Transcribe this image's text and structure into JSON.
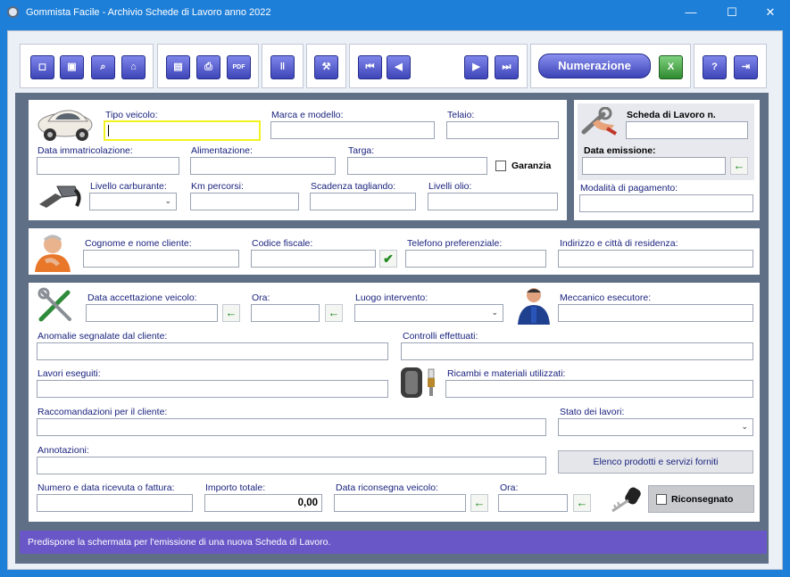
{
  "window": {
    "title": "Gommista Facile - Archivio Schede di Lavoro anno 2022",
    "minimize": "—",
    "maximize": "☐",
    "close": "✕"
  },
  "toolbar": {
    "new_icon": "new-document-icon",
    "save_icon": "floppy-disk-icon",
    "search_icon": "magnifier-icon",
    "reset_icon": "home-icon",
    "preview_icon": "preview-icon",
    "print_icon": "printer-icon",
    "pdf_icon": "pdf-icon",
    "attach_icon": "paperclip-icon",
    "tools_icon": "tools-icon",
    "first_icon": "first-record-icon",
    "prev_icon": "previous-record-icon",
    "next_icon": "next-record-icon",
    "last_icon": "last-record-icon",
    "numerazione_label": "Numerazione",
    "excel_icon": "excel-icon",
    "help_icon": "help-icon",
    "exit_icon": "exit-icon",
    "glyph_new": "◻",
    "glyph_save": "▣",
    "glyph_search": "⌕",
    "glyph_home": "⌂",
    "glyph_preview": "▤",
    "glyph_print": "⎙",
    "glyph_pdf": "PDF",
    "glyph_attach": "‖",
    "glyph_tools": "⚒",
    "glyph_first": "⏮",
    "glyph_prev": "◀",
    "glyph_next": "▶",
    "glyph_last": "⏭",
    "glyph_excel": "X",
    "glyph_help": "?",
    "glyph_exit": "⇥"
  },
  "vehicle": {
    "tipo_label": "Tipo veicolo:",
    "tipo_value": "",
    "marca_label": "Marca e modello:",
    "marca_value": "",
    "telaio_label": "Telaio:",
    "telaio_value": "",
    "immatricolazione_label": "Data immatricolazione:",
    "immatricolazione_value": "",
    "alimentazione_label": "Alimentazione:",
    "alimentazione_value": "",
    "targa_label": "Targa:",
    "targa_value": "",
    "garanzia_label": "Garanzia",
    "carburante_label": "Livello carburante:",
    "carburante_value": "",
    "km_label": "Km percorsi:",
    "km_value": "",
    "tagliando_label": "Scadenza tagliando:",
    "tagliando_value": "",
    "olio_label": "Livelli olio:",
    "olio_value": ""
  },
  "scheda": {
    "numero_label": "Scheda di Lavoro n.",
    "numero_value": "",
    "emissione_label": "Data emissione:",
    "emissione_value": "",
    "pagamento_label": "Modalità di pagamento:",
    "pagamento_value": ""
  },
  "cliente": {
    "nome_label": "Cognome e nome cliente:",
    "nome_value": "",
    "cf_label": "Codice fiscale:",
    "cf_value": "",
    "telefono_label": "Telefono preferenziale:",
    "telefono_value": "",
    "indirizzo_label": "Indirizzo e città di residenza:",
    "indirizzo_value": ""
  },
  "lavoro": {
    "accettazione_label": "Data accettazione veicolo:",
    "accettazione_value": "",
    "ora_label": "Ora:",
    "ora_value": "",
    "luogo_label": "Luogo intervento:",
    "luogo_value": "",
    "meccanico_label": "Meccanico esecutore:",
    "meccanico_value": "",
    "anomalie_label": "Anomalie segnalate dal cliente:",
    "anomalie_value": "",
    "controlli_label": "Controlli effettuati:",
    "controlli_value": "",
    "eseguiti_label": "Lavori eseguiti:",
    "eseguiti_value": "",
    "ricambi_label": "Ricambi e materiali utilizzati:",
    "ricambi_value": "",
    "raccomandazioni_label": "Raccomandazioni per il cliente:",
    "raccomandazioni_value": "",
    "stato_label": "Stato dei lavori:",
    "stato_value": "",
    "annotazioni_label": "Annotazioni:",
    "annotazioni_value": "",
    "elenco_button": "Elenco prodotti e servizi forniti",
    "ricevuta_label": "Numero e data ricevuta o fattura:",
    "ricevuta_value": "",
    "importo_label": "Importo totale:",
    "importo_value": "0,00",
    "riconsegna_label": "Data riconsegna veicolo:",
    "riconsegna_value": "",
    "ora2_label": "Ora:",
    "ora2_value": "",
    "riconsegnato_label": "Riconsegnato"
  },
  "status": {
    "text": "Predispone la schermata per l'emissione di una nuova Scheda di Lavoro."
  },
  "colors": {
    "accent": "#1e7fd8",
    "status_bar": "#6a57c7",
    "focus": "#f2f21e",
    "button_blue": "#3d45b8",
    "arrow_green": "#1f8a1f"
  },
  "glyphs": {
    "arrow_left": "←",
    "check": "✔",
    "chevron": "⌄"
  }
}
